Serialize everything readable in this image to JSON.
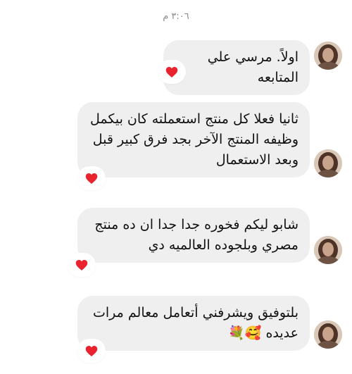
{
  "chat": {
    "timestamp": "٣:٠٦ م",
    "messages": [
      {
        "text": "اولاً. مرسي علي المتابعه",
        "reaction": "red-heart"
      },
      {
        "text": "ثانيا فعلا  كل منتج استعملته كان بيكمل\nوظيفه المنتج الآخر  بجد فرق كبير قبل\nوبعد   الاستعمال",
        "reaction": "red-heart"
      },
      {
        "text": "شابو ليكم     فخوره جدا جدا   ان ده منتج\nمصري     وبلجوده العالميه دي",
        "reaction": "red-heart"
      },
      {
        "text": "بلتوفيق   ويشرفني أتعامل معالم   مرات\nعديده 🥰💐",
        "reaction": "red-heart"
      }
    ]
  },
  "colors": {
    "bubble": "#efefef",
    "heart": "#e8232e",
    "timestamp": "#8a8a8a"
  }
}
